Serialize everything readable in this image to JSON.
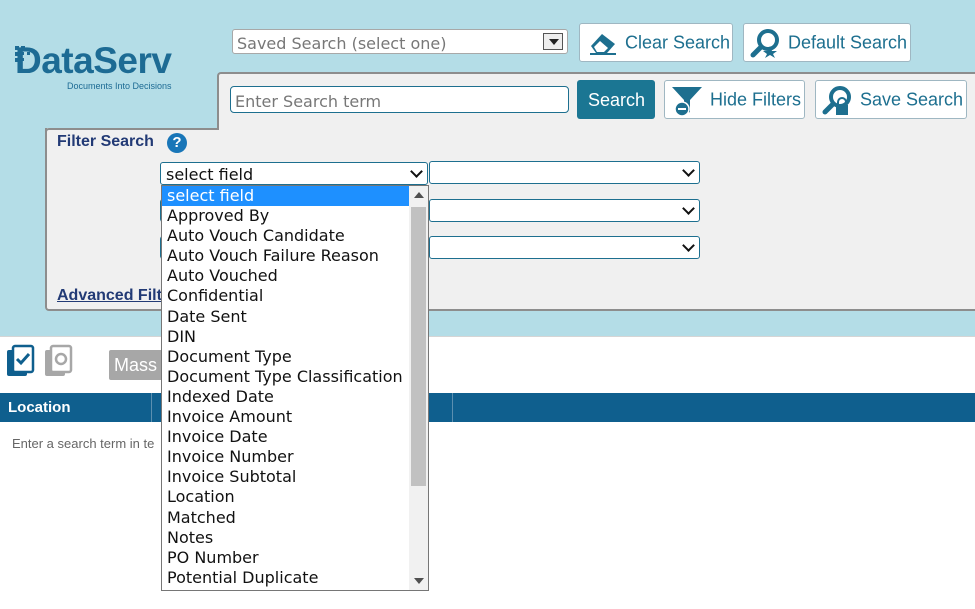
{
  "app": {
    "logo_text": "DataServ",
    "logo_tagline": "Documents Into Decisions",
    "brand_color": "#1d6b94",
    "header_bg": "#b4dde7"
  },
  "top_toolbar": {
    "saved_search_placeholder": "Saved Search (select one)",
    "clear_search_label": "Clear Search",
    "default_search_label": "Default Search"
  },
  "search_bar": {
    "placeholder": "Enter Search term",
    "search_label": "Search",
    "hide_filters_label": "Hide Filters",
    "save_search_label": "Save Search"
  },
  "filter": {
    "title": "Filter Search",
    "help_icon": "question-circle-icon",
    "help_glyph": "?",
    "field_select_value": "select field",
    "advanced_link": "Advanced Filter",
    "field_options": [
      "select field",
      "Approved By",
      "Auto Vouch Candidate",
      "Auto Vouch Failure Reason",
      "Auto Vouched",
      "Confidential",
      "Date Sent",
      "DIN",
      "Document Type",
      "Document Type Classification",
      "Indexed Date",
      "Invoice Amount",
      "Invoice Date",
      "Invoice Number",
      "Invoice Subtotal",
      "Location",
      "Matched",
      "Notes",
      "PO Number",
      "Potential Duplicate"
    ],
    "selected_option": "select field"
  },
  "results": {
    "mass_button_label": "Mass",
    "columns": [
      "Location"
    ],
    "empty_message": "Enter a search term in te",
    "header_color": "#0f5f8e"
  }
}
